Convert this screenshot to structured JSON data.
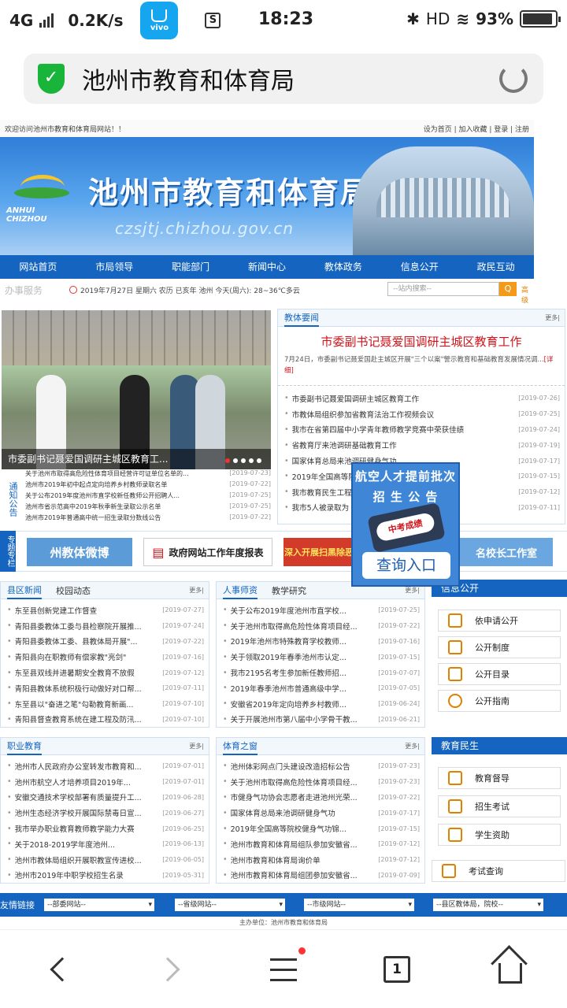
{
  "status": {
    "network": "4G",
    "speed": "0.2K/s",
    "vivo_label": "vivo",
    "sim_icon": "S",
    "time": "18:23",
    "hd": "HD",
    "battery": "93%",
    "battery_level": 0.93
  },
  "browser": {
    "title": "池州市教育和体育局",
    "tabs_count": "1"
  },
  "site": {
    "welcome": "欢迎访问池州市教育和体育局网站！！",
    "top_links": "设为首页 | 加入收藏 | 登录 | 注册",
    "logo_text": "ANHUI CHIZHOU",
    "banner_title": "池州市教育和体育局",
    "banner_url": "czsjtj.chizhou.gov.cn",
    "nav": [
      "网站首页",
      "市局领导",
      "职能部门",
      "新闻中心",
      "教体政务",
      "信息公开",
      "政民互动"
    ],
    "service_tab": "办事服务",
    "date_weather": "2019年7月27日 星期六 农历 已亥年 池州 今天(周六): 28~36℃多云",
    "search_placeholder": "--站内搜索--",
    "search_btn": "Q",
    "search_adv": "高级",
    "photo_caption": "市委副书记聂爱国调研主城区教育工...",
    "notice_label": "通知公告",
    "notices": [
      {
        "text": "关于池州市取得高危险性体育项目经营许可证单位名单的...",
        "date": "[2019-07-23]"
      },
      {
        "text": "池州市2019年初中起点定向培养乡村教师录取名单",
        "date": "[2019-07-22]"
      },
      {
        "text": "关于公布2019年度池州市直学校新任教师公开招聘人...",
        "date": "[2019-07-25]"
      },
      {
        "text": "池州市省示范高中2019年秋季新生录取公示名单",
        "date": "[2019-07-25]"
      },
      {
        "text": "池州市2019年普通高中统一招生录取分数线公告",
        "date": "[2019-07-22]"
      }
    ],
    "jiaoti": {
      "head": "教体要闻",
      "more": "更多|",
      "headline": "市委副书记聂爱国调研主城区教育工作",
      "summary": "7月24日，市委副书记聂爱国赴主城区开展\"三个以案\"警示教育和基础教育发展情况调...",
      "detail": "[详细]",
      "items": [
        {
          "text": "市委副书记聂爱国调研主城区教育工作",
          "date": "[2019-07-26]"
        },
        {
          "text": "市教体局组织参加省教育法治工作视频会议",
          "date": "[2019-07-25]"
        },
        {
          "text": "我市在省第四届中小学青年教师教学竞赛中荣获佳绩",
          "date": "[2019-07-24]"
        },
        {
          "text": "省教育厅来池调研基础教育工作",
          "date": "[2019-07-19]"
        },
        {
          "text": "国家体育总局来池调研健身气功",
          "date": "[2019-07-17]"
        },
        {
          "text": "2019年全国高等院校健身气功锦标赛",
          "date": "[2019-07-15]"
        },
        {
          "text": "我市教育民生工程",
          "date": "[2019-07-12]"
        },
        {
          "text": "我市5人被录取为",
          "date": "[2019-07-11]"
        }
      ]
    },
    "special_label": "专题专栏",
    "special": [
      "州教体微博",
      "政府网站工作年度报表",
      "深入开展扫黑除恶",
      "名校长工作室"
    ],
    "ad": {
      "line1": "航空人才提前批次",
      "line2": "招 生 公 告",
      "phone_text": "中考成绩",
      "button": "查询入口"
    },
    "county": {
      "tab1": "县区新闻",
      "tab2": "校园动态",
      "more": "更多|",
      "items": [
        {
          "text": "东至县创新党建工作督查",
          "date": "[2019-07-27]"
        },
        {
          "text": "青阳县委教体工委与县检察院开展推...",
          "date": "[2019-07-24]"
        },
        {
          "text": "青阳县委教体工委、县教体局开展\"...",
          "date": "[2019-07-22]"
        },
        {
          "text": "青阳县向在职教师有偿家教\"亮剑\"",
          "date": "[2019-07-16]"
        },
        {
          "text": "东至县双线并进暑期安全教育不放假",
          "date": "[2019-07-12]"
        },
        {
          "text": "青阳县教体系统积极行动做好对口帮...",
          "date": "[2019-07-11]"
        },
        {
          "text": "东至县以\"奋进之笔\"勾勒教育新画...",
          "date": "[2019-07-10]"
        },
        {
          "text": "青阳县督查教育系统在建工程及防汛...",
          "date": "[2019-07-10]"
        }
      ]
    },
    "personnel": {
      "tab1": "人事师资",
      "tab2": "教学研究",
      "more": "更多|",
      "items": [
        {
          "text": "关于公布2019年度池州市直学校...",
          "date": "[2019-07-25]"
        },
        {
          "text": "关于池州市取得高危险性体育项目经...",
          "date": "[2019-07-22]"
        },
        {
          "text": "2019年池州市特殊教育学校教师...",
          "date": "[2019-07-16]"
        },
        {
          "text": "关于领取2019年春季池州市认定...",
          "date": "[2019-07-15]"
        },
        {
          "text": "我市2195名考生参加新任教师招...",
          "date": "[2019-07-07]"
        },
        {
          "text": "2019年春季池州市普通高级中学...",
          "date": "[2019-07-05]"
        },
        {
          "text": "安徽省2019年定向培养乡村教师...",
          "date": "[2019-06-24]"
        },
        {
          "text": "关于开展池州市第八届中小学骨干教...",
          "date": "[2019-06-21]"
        }
      ]
    },
    "info_open": {
      "head": "信息公开",
      "items": [
        "依申请公开",
        "公开制度",
        "公开目录",
        "公开指南"
      ]
    },
    "vocational": {
      "head": "职业教育",
      "more": "更多|",
      "items": [
        {
          "text": "池州市人民政府办公室转发市教育和...",
          "date": "[2019-07-01]"
        },
        {
          "text": "池州市航空人才培养项目2019年...",
          "date": "[2019-07-01]"
        },
        {
          "text": "安徽交通技术学校部署有质量提升工...",
          "date": "[2019-06-28]"
        },
        {
          "text": "池州生态经济学校开展国际禁毒日宣...",
          "date": "[2019-06-27]"
        },
        {
          "text": "我市举办职业教育教师教学能力大赛",
          "date": "[2019-06-25]"
        },
        {
          "text": "关于2018-2019学年度池州...",
          "date": "[2019-06-13]"
        },
        {
          "text": "池州市教体局组织开展职教宣传进校...",
          "date": "[2019-06-05]"
        },
        {
          "text": "池州市2019年中职学校招生名录",
          "date": "[2019-05-31]"
        }
      ]
    },
    "sports": {
      "head": "体育之窗",
      "more": "更多|",
      "items": [
        {
          "text": "池州体彩网点门头建设改造招标公告",
          "date": "[2019-07-23]"
        },
        {
          "text": "关于池州市取得高危险性体育项目经...",
          "date": "[2019-07-23]"
        },
        {
          "text": "市健身气功协会志愿者走进池州光荣...",
          "date": "[2019-07-22]"
        },
        {
          "text": "国家体育总局来池调研健身气功",
          "date": "[2019-07-17]"
        },
        {
          "text": "2019年全国高等院校健身气功锦...",
          "date": "[2019-07-15]"
        },
        {
          "text": "池州市教育和体育局组队参加安徽省...",
          "date": "[2019-07-12]"
        },
        {
          "text": "池州市教育和体育局询价单",
          "date": "[2019-07-12]"
        },
        {
          "text": "池州市教育和体育局组团参加安徽省...",
          "date": "[2019-07-09]"
        }
      ]
    },
    "livelihood": {
      "head": "教育民生",
      "items": [
        "教育督导",
        "招生考试",
        "学生资助"
      ],
      "exam_query": "考试查询"
    },
    "links_label": "友情链接",
    "selects": [
      "--部委网站--",
      "--省级网站--",
      "--市级网站--",
      "--县区教体局，院校--"
    ],
    "footer": "主办单位：池州市教育和体育局"
  }
}
